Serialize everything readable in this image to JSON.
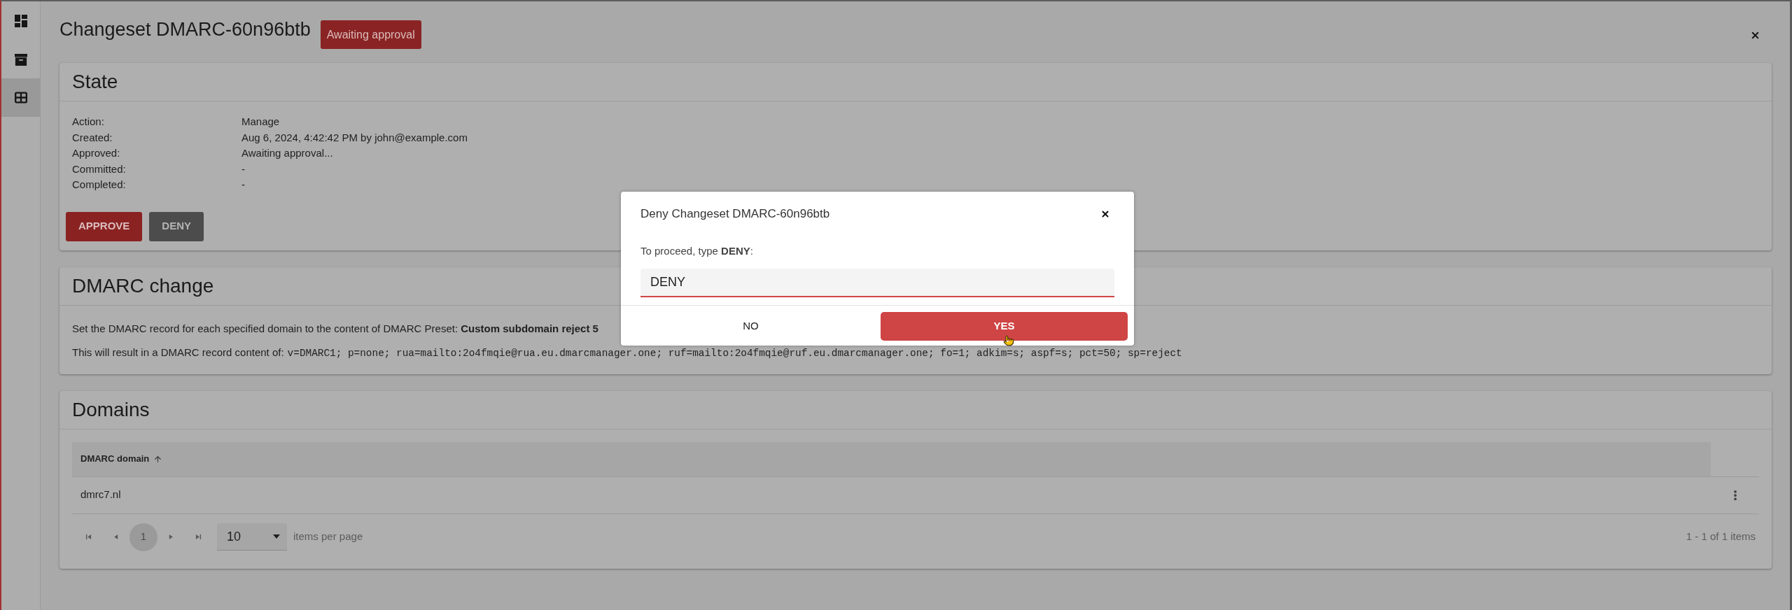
{
  "sidebar": {
    "items": [
      {
        "selected": false
      },
      {
        "selected": false
      },
      {
        "selected": true
      }
    ]
  },
  "page": {
    "title": "Changeset DMARC-60n96btb",
    "status_badge": "Awaiting approval"
  },
  "state_card": {
    "title": "State",
    "fields": [
      {
        "label": "Action:",
        "value": "Manage"
      },
      {
        "label": "Created:",
        "value": "Aug 6, 2024, 4:42:42 PM by john@example.com"
      },
      {
        "label": "Approved:",
        "value": "Awaiting approval..."
      },
      {
        "label": "Committed:",
        "value": "-"
      },
      {
        "label": "Completed:",
        "value": "-"
      }
    ],
    "buttons": [
      {
        "label": "APPROVE",
        "kind": "primary"
      },
      {
        "label": "DENY",
        "kind": "secondary"
      }
    ]
  },
  "dmarc_change_card": {
    "title": "DMARC change",
    "description": "Set the DMARC record for each specified domain to the content of DMARC Preset: **Custom subdomain reject 5**",
    "result_label": "This will result in a DMARC record content of:",
    "record": "v=DMARC1; p=none; rua=mailto:2o4fmqie@rua.eu.dmarcmanager.one; ruf=mailto:2o4fmqie@ruf.eu.dmarcmanager.one; fo=1; adkim=s; aspf=s; pct=50; sp=reject"
  },
  "domains_card": {
    "title": "Domains",
    "table": {
      "columns": [
        {
          "label": "DMARC domain",
          "sorted_ascending": true
        }
      ],
      "rows": [
        {
          "cells": [
            "dmrc7.nl"
          ]
        }
      ]
    },
    "pagination": {
      "pages": [
        {
          "label": "1",
          "selected": true
        }
      ],
      "page_size": "10",
      "page_size_suffix": "items per page",
      "summary": "1 - 1 of 1 items"
    }
  },
  "dialog": {
    "title": "Deny Changeset DMARC-60n96btb",
    "prompt": "To proceed, type **DENY**:",
    "input": {
      "value": "DENY",
      "focused": true
    },
    "buttons": [
      {
        "label": "NO",
        "kind": "text"
      },
      {
        "label": "YES",
        "kind": "danger"
      }
    ]
  }
}
